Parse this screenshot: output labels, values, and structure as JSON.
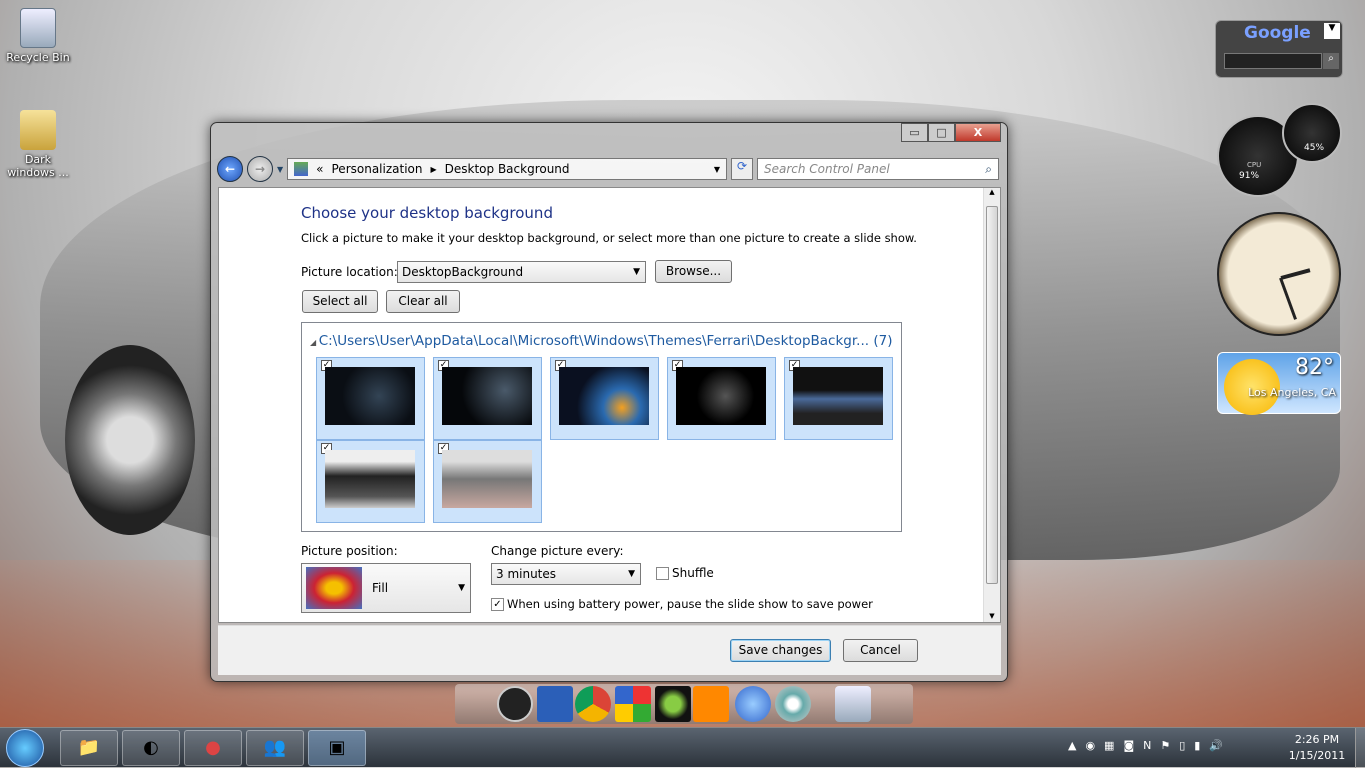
{
  "desktop": {
    "icons": [
      {
        "label": "Recycle Bin"
      },
      {
        "label": "Dark windows ..."
      }
    ]
  },
  "window": {
    "controls": {
      "minimize": "▭",
      "maximize": "□",
      "close": "X"
    },
    "breadcrumb": {
      "sep": "«",
      "items": [
        "Personalization",
        "Desktop Background"
      ]
    },
    "search_placeholder": "Search Control Panel",
    "title": "Choose your desktop background",
    "description": "Click a picture to make it your desktop background, or select more than one picture to create a slide show.",
    "picture_location_label": "Picture location:",
    "picture_location_value": "DesktopBackground",
    "browse_label": "Browse...",
    "select_all_label": "Select all",
    "clear_all_label": "Clear all",
    "gallery": {
      "group_header": "C:\\Users\\User\\AppData\\Local\\Microsoft\\Windows\\Themes\\Ferrari\\DesktopBackgr... (7)",
      "images": [
        {
          "checked": true,
          "desc": "windows-dark-1"
        },
        {
          "checked": true,
          "desc": "windows-dark-2"
        },
        {
          "checked": true,
          "desc": "windows-logo-light"
        },
        {
          "checked": true,
          "desc": "windows-logo-black"
        },
        {
          "checked": true,
          "desc": "blue-ferrari"
        },
        {
          "checked": true,
          "desc": "black-ferrari"
        },
        {
          "checked": true,
          "desc": "silver-ferrari"
        }
      ]
    },
    "picture_position_label": "Picture position:",
    "picture_position_value": "Fill",
    "change_every_label": "Change picture every:",
    "change_every_value": "3 minutes",
    "shuffle_label": "Shuffle",
    "shuffle_checked": false,
    "battery_label": "When using battery power, pause the slide show to save power",
    "battery_checked": true,
    "save_label": "Save changes",
    "cancel_label": "Cancel"
  },
  "gadgets": {
    "search_brand": "Google",
    "cpu_percent": "91%",
    "memory_percent": "45%",
    "cpu_label": "CPU",
    "weather_temp": "82°",
    "weather_city": "Los Angeles, CA",
    "clock_time": "2:26"
  },
  "taskbar": {
    "time": "2:26 PM",
    "date": "1/15/2011"
  },
  "colors": {
    "accent": "#1e3287",
    "link": "#1e5aa0",
    "selection": "#cce3fb"
  }
}
